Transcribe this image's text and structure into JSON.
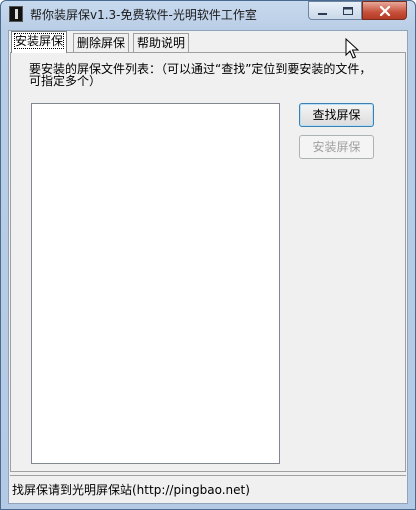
{
  "window": {
    "title": "帮你装屏保v1.3-免费软件-光明软件工作室",
    "icon": "app-icon"
  },
  "tabs": [
    {
      "label": "安装屏保",
      "active": true
    },
    {
      "label": "删除屏保",
      "active": false
    },
    {
      "label": "帮助说明",
      "active": false
    }
  ],
  "install_panel": {
    "instruction_line1": "要安装的屏保文件列表：（可以通过“查找”定位到要安装的文件，",
    "instruction_line2": "可指定多个）",
    "find_button": "查找屏保",
    "install_button": "安装屏保",
    "install_button_enabled": false
  },
  "statusbar": {
    "text": "找屏保请到光明屏保站(http://pingbao.net)"
  },
  "colors": {
    "frame": "#b9cde6",
    "close_button": "#c7503a",
    "client_bg": "#f0f0f0"
  }
}
